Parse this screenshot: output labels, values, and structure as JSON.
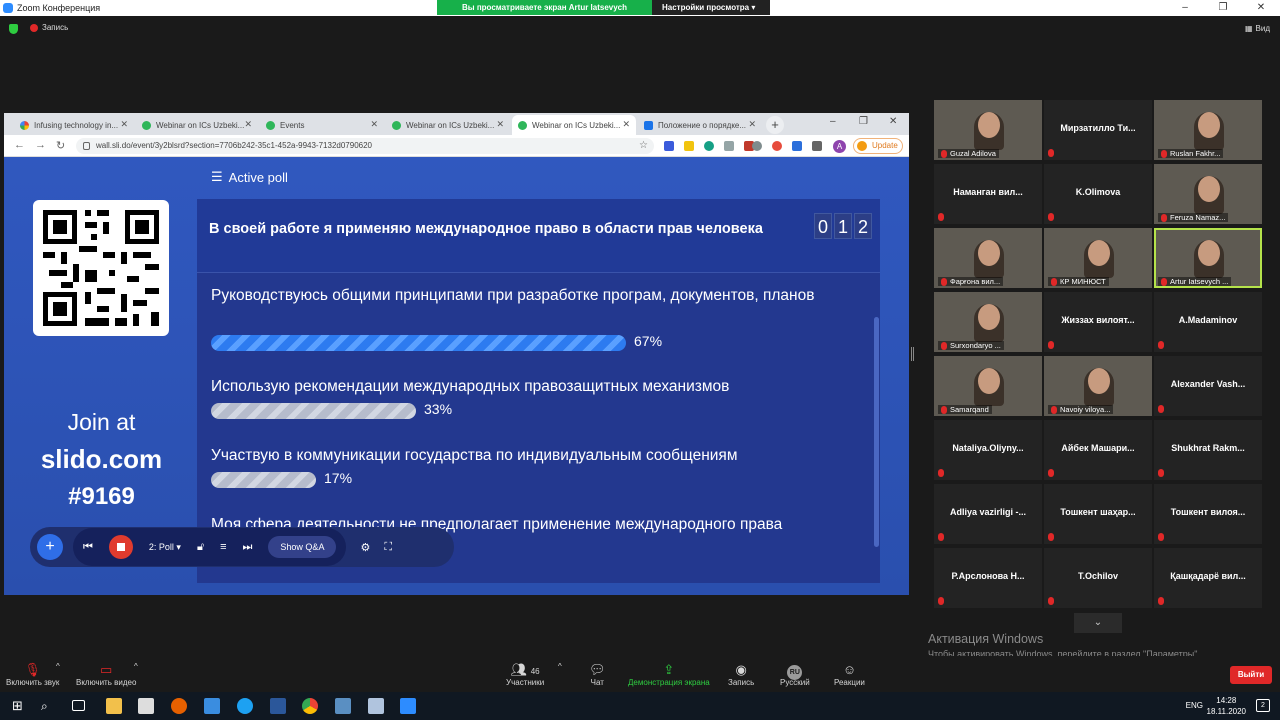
{
  "zoom": {
    "window_title": "Zoom Конференция",
    "share_banner": "Вы просматриваете экран Artur Iatsevych OHCHR",
    "view_options": "Настройки просмотра",
    "recording_label": "Запись",
    "view_label": "Вид",
    "toolbar": {
      "mute": "Включить звук",
      "video": "Включить видео",
      "participants": "Участники",
      "participants_count": "46",
      "chat": "Чат",
      "share": "Демонстрация экрана",
      "record": "Запись",
      "language": "Русский",
      "language_badge": "RU",
      "reactions": "Реакции",
      "leave": "Выйти"
    },
    "gallery": [
      {
        "name": "Guzal Adilova",
        "video": true
      },
      {
        "name": "Мирзатилло Ти...",
        "video": false
      },
      {
        "name": "Ruslan Fakhr...",
        "video": true
      },
      {
        "name": "Наманган вил...",
        "video": false
      },
      {
        "name": "K.Olimova",
        "video": false
      },
      {
        "name": "Feruza Namaz...",
        "video": true
      },
      {
        "name": "Фарғона вил...",
        "video": true
      },
      {
        "name": "КР МИНЮСТ",
        "video": true
      },
      {
        "name": "Artur Iatsevych ...",
        "video": true,
        "active": true
      },
      {
        "name": "Surxondaryo ...",
        "video": true
      },
      {
        "name": "Жиззах вилоят...",
        "video": false
      },
      {
        "name": "A.Madaminov",
        "video": false
      },
      {
        "name": "Samarqand",
        "video": true
      },
      {
        "name": "Navoiy viloya...",
        "video": true
      },
      {
        "name": "Alexander Vash...",
        "video": false
      },
      {
        "name": "Nataliya.Oliyny...",
        "video": false
      },
      {
        "name": "Айбек Машари...",
        "video": false
      },
      {
        "name": "Shukhrat Rakm...",
        "video": false
      },
      {
        "name": "Adliya vazirligi -...",
        "video": false
      },
      {
        "name": "Тошкент шаҳар...",
        "video": false
      },
      {
        "name": "Тошкент вилоя...",
        "video": false
      },
      {
        "name": "Р.Арслонова Н...",
        "video": false
      },
      {
        "name": "T.Ochilov",
        "video": false
      },
      {
        "name": "Қашқадарё вил...",
        "video": false
      }
    ]
  },
  "browser": {
    "tabs": [
      {
        "title": "Infusing technology in...",
        "icon": "google-icon"
      },
      {
        "title": "Webinar on ICs Uzbeki...",
        "icon": "slido-icon"
      },
      {
        "title": "Events",
        "icon": "slido-icon"
      },
      {
        "title": "Webinar on ICs Uzbeki...",
        "icon": "slido-icon"
      },
      {
        "title": "Webinar on ICs Uzbeki...",
        "icon": "slido-icon",
        "active": true
      },
      {
        "title": "Положение о порядке...",
        "icon": "doc-icon"
      }
    ],
    "url": "wall.sli.do/event/3y2blsrd?section=7706b242-35c1-452a-9943-7132d0790620",
    "update_label": "Update",
    "avatar_letter": "A"
  },
  "slido": {
    "section_label": "Active poll",
    "join_at": "Join at",
    "site": "slido.com",
    "code": "#9169",
    "question": "В своей работе я применяю международное право в области прав человека",
    "counter": [
      "0",
      "1",
      "2"
    ],
    "options": [
      {
        "text": "Руководствуюсь общими принципами при разработке програм, документов, планов",
        "percent": 67,
        "percent_label": "67%",
        "leading": true
      },
      {
        "text": "Использую рекомендации международных правозащитных механизмов",
        "percent": 33,
        "percent_label": "33%"
      },
      {
        "text": "Участвую в коммуникации государства по индивидуальным сообщениям",
        "percent": 17,
        "percent_label": "17%"
      },
      {
        "text": "Моя сфера деятельности не предполагает применение международного права",
        "percent": null,
        "percent_label": ""
      }
    ],
    "control_bar": {
      "poll_selector": "2: Poll",
      "show_qa": "Show Q&A"
    }
  },
  "windows": {
    "activate_title": "Активация Windows",
    "activate_text": "Чтобы активировать Windows, перейдите в раздел \"Параметры\".",
    "language": "ENG",
    "time": "14:28",
    "date": "18.11.2020",
    "notifications": "2"
  }
}
